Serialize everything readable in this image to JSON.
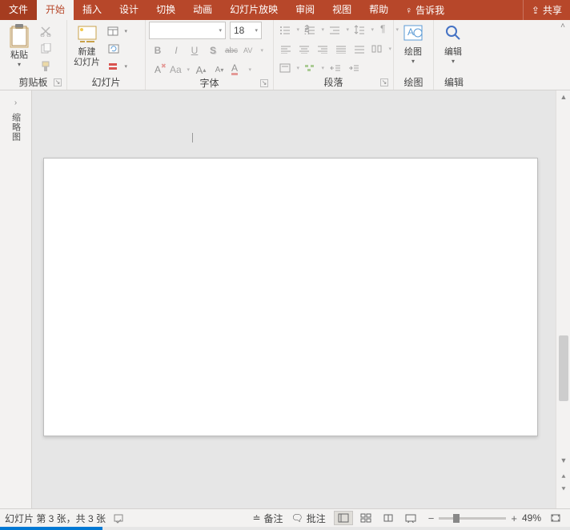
{
  "tabs": {
    "file": "文件",
    "home": "开始",
    "insert": "插入",
    "design": "设计",
    "transition": "切换",
    "animation": "动画",
    "slideshow": "幻灯片放映",
    "review": "审阅",
    "view": "视图",
    "help": "帮助",
    "tellme": "告诉我",
    "share": "共享"
  },
  "groups": {
    "clipboard": "剪贴板",
    "slides": "幻灯片",
    "font": "字体",
    "paragraph": "段落",
    "drawing": "绘图",
    "editing": "编辑"
  },
  "clipboard": {
    "paste": "粘贴"
  },
  "slides": {
    "newSlide": "新建\n幻灯片"
  },
  "font": {
    "size": "18",
    "bold": "B",
    "italic": "I",
    "underline": "U",
    "shadow": "S",
    "strike": "abc",
    "charSpace": "AV",
    "clear": "A",
    "aa": "Aa",
    "grow": "A",
    "shrink": "A",
    "colorA": "A"
  },
  "drawing": {
    "label": "绘图"
  },
  "editing": {
    "label": "编辑"
  },
  "thumb": {
    "label": "缩略图"
  },
  "status": {
    "slideInfo": "幻灯片 第 3 张，共 3 张",
    "notes": "备注",
    "comments": "批注",
    "zoom": "49%"
  },
  "progress": {
    "percent": 18
  }
}
